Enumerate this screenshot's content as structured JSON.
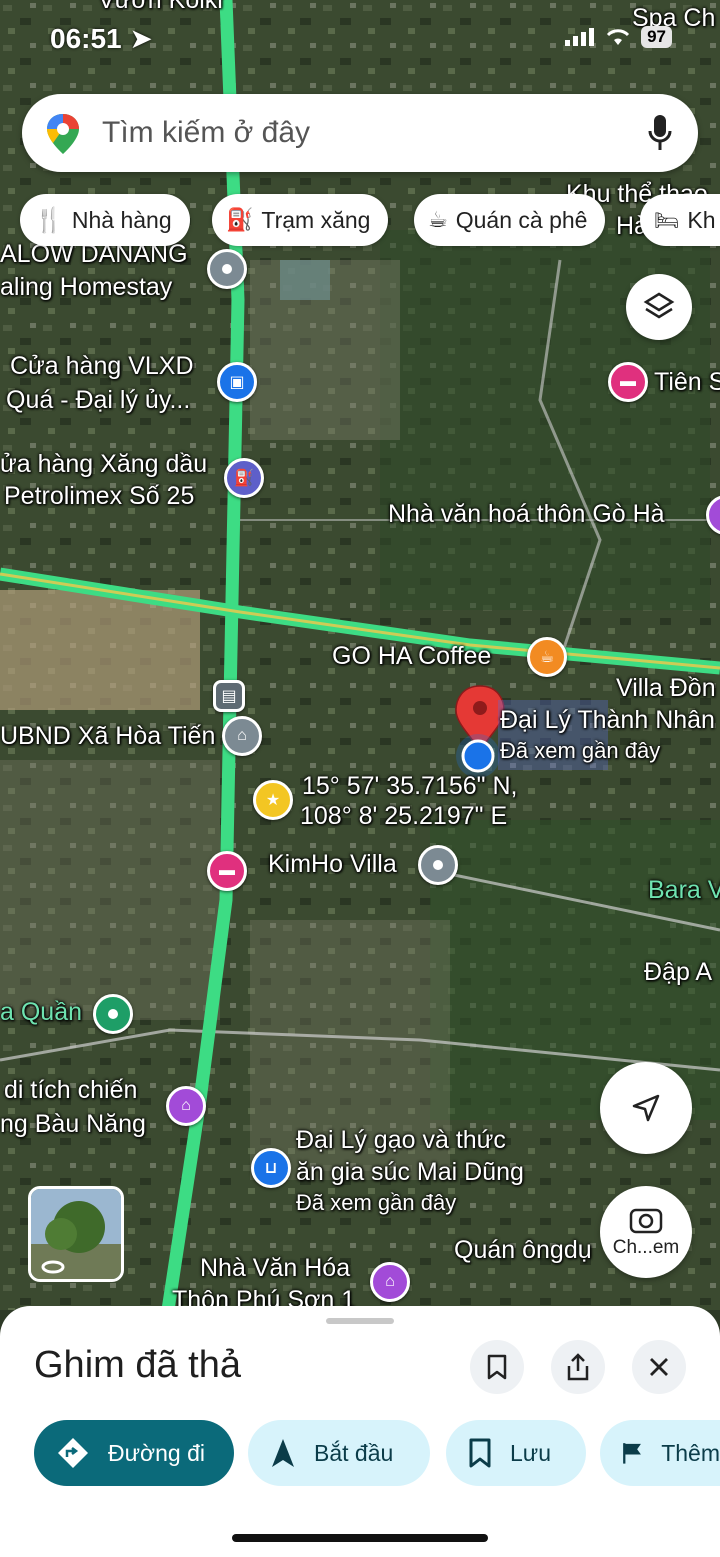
{
  "status_bar": {
    "time": "06:51",
    "battery": "97"
  },
  "search": {
    "placeholder": "Tìm kiếm ở đây"
  },
  "chips": [
    "Nhà hàng",
    "Trạm xăng",
    "Quán cà phê",
    "Kh"
  ],
  "map_labels": {
    "top_partial": "Vườn Koiki",
    "spa": "Spa Ch",
    "bungalow": "ALOW DANANG",
    "homestay": "aling Homestay",
    "khu_the_thao": "Khu thể thao",
    "khu_the_thao_2": "Hà",
    "vlxd_1": "Cửa hàng VLXD",
    "vlxd_2": "Quá - Đại lý ủy...",
    "tien": "Tiên S",
    "xang_1": "ửa hàng Xăng dầu",
    "xang_2": "Petrolimex Số 25",
    "nha_van_hoa": "Nhà văn hoá thôn Gò Hà",
    "goha": "GO HA Coffee",
    "villa_dong": "Villa Đồn",
    "ubnd": "UBND Xã Hòa Tiến",
    "dai_ly_thanh_nhan": "Đại Lý Thành Nhân",
    "da_xem_1": "Đã xem gần đây",
    "coord_1": "15° 57' 35.7156\" N,",
    "coord_2": "108° 8' 25.2197\" E",
    "kimho": "KimHo Villa",
    "bara": "Bara V",
    "dap": "Đập A",
    "quan": "a Quần",
    "di_tich_1": "di tích chiến",
    "di_tich_2": "ng Bàu Năng",
    "mai_dung_1": "Đại Lý gạo và thức",
    "mai_dung_2": "ăn gia súc Mai Dũng",
    "da_xem_2": "Đã xem gần đây",
    "quan_ong": "Quán ôngdụ",
    "nha_van_hoa_2_1": "Nhà Văn Hóa",
    "nha_van_hoa_2_2": "Thôn Phú Sơn 1"
  },
  "camera_button": {
    "label": "Ch...em"
  },
  "sheet": {
    "title": "Ghim đã thả",
    "actions": [
      "Đường đi",
      "Bắt đầu",
      "Lưu",
      "Thêm"
    ]
  },
  "colors": {
    "accent": "#0b6a7a",
    "chip_bg": "#d7f3fb",
    "pin_red": "#e53935",
    "road": "#3ddc84",
    "location_blue": "#1a73e8"
  }
}
